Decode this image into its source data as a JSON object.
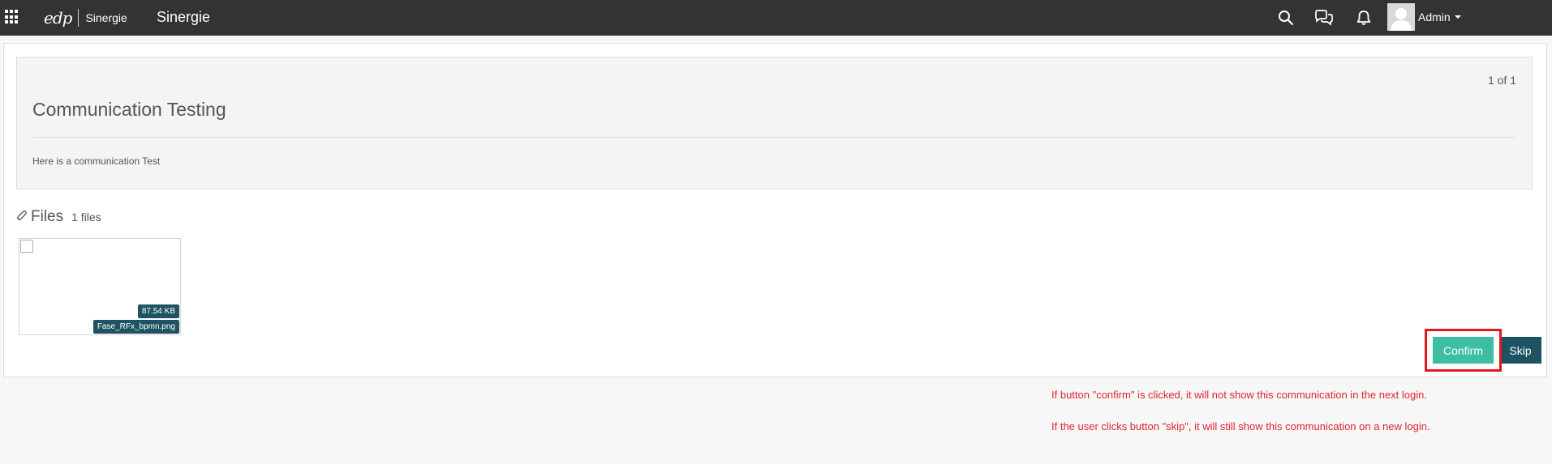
{
  "topbar": {
    "logo_mark": "edp",
    "logo_product": "Sinergie",
    "app_title": "Sinergie",
    "user_name": "Admin",
    "icons": [
      "apps-grid-icon",
      "search-icon",
      "chat-icon",
      "bell-icon",
      "user-avatar-icon",
      "caret-down-icon"
    ]
  },
  "communication": {
    "pager": "1 of 1",
    "title": "Communication Testing",
    "body": "Here is a communication Test"
  },
  "files": {
    "title": "Files",
    "count": "1 files",
    "items": [
      {
        "size": "87.54 KB",
        "name": "Fase_RFx_bpmn.png"
      }
    ]
  },
  "actions": {
    "confirm_label": "Confirm",
    "skip_label": "Skip"
  },
  "notes": {
    "confirm_note": "If button \"confirm\" is clicked, it will not show this communication in the next login.",
    "skip_note": "If the user clicks button \"skip\", it will still show this communication on a new login."
  },
  "colors": {
    "topbar_bg": "#333333",
    "confirm": "#3cbea2",
    "skip": "#1e5461",
    "annotation_red": "#e4161b"
  }
}
